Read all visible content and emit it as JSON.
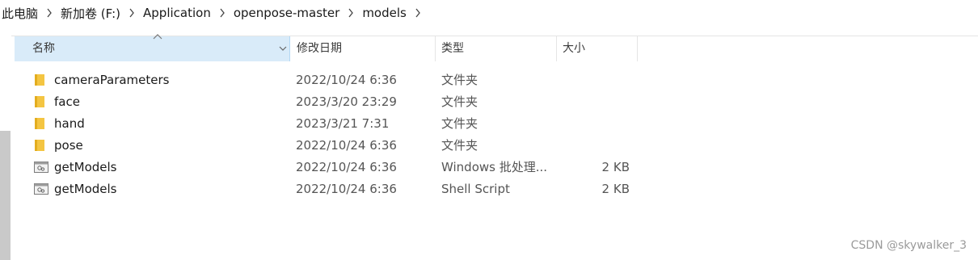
{
  "breadcrumb": {
    "items": [
      "此电脑",
      "新加卷 (F:)",
      "Application",
      "openpose-master",
      "models"
    ]
  },
  "columns": {
    "name": "名称",
    "date": "修改日期",
    "type": "类型",
    "size": "大小"
  },
  "files": [
    {
      "icon": "folder-icon",
      "name": "cameraParameters",
      "date": "2022/10/24 6:36",
      "type": "文件夹",
      "size": ""
    },
    {
      "icon": "folder-icon",
      "name": "face",
      "date": "2023/3/20 23:29",
      "type": "文件夹",
      "size": ""
    },
    {
      "icon": "folder-icon",
      "name": "hand",
      "date": "2023/3/21 7:31",
      "type": "文件夹",
      "size": ""
    },
    {
      "icon": "folder-icon",
      "name": "pose",
      "date": "2022/10/24 6:36",
      "type": "文件夹",
      "size": ""
    },
    {
      "icon": "batch-file-icon",
      "name": "getModels",
      "date": "2022/10/24 6:36",
      "type": "Windows 批处理...",
      "size": "2 KB"
    },
    {
      "icon": "script-file-icon",
      "name": "getModels",
      "date": "2022/10/24 6:36",
      "type": "Shell Script",
      "size": "2 KB"
    }
  ],
  "watermark": "CSDN @skywalker_3",
  "colors": {
    "header_selected_bg": "#d9ebf9",
    "folder_yellow": "#f4c542",
    "secondary_text": "#555555"
  }
}
